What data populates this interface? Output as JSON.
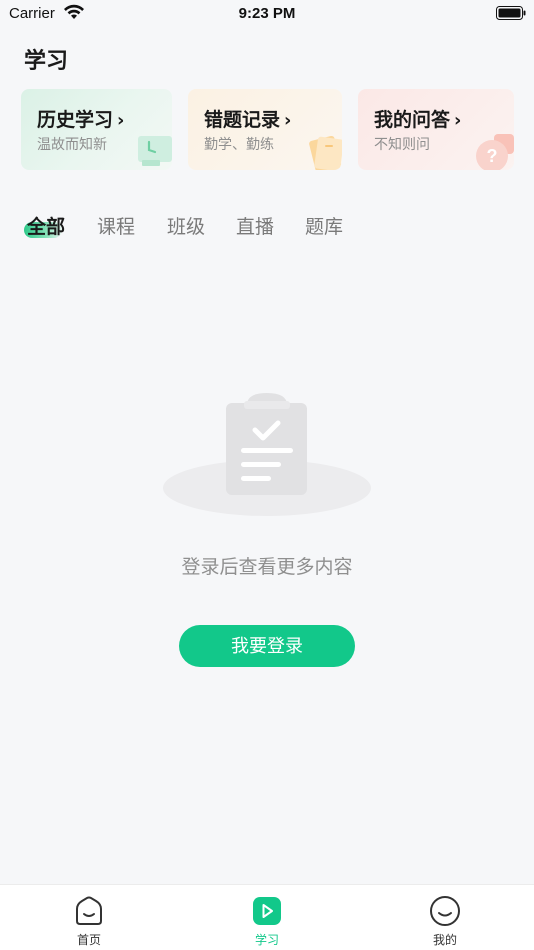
{
  "status_bar": {
    "carrier": "Carrier",
    "time": "9:23 PM"
  },
  "page": {
    "title": "学习"
  },
  "quick_cards": [
    {
      "title": "历史学习",
      "subtitle": "温故而知新",
      "icon": "monitor-clock-icon",
      "accent": "#2ec98a"
    },
    {
      "title": "错题记录",
      "subtitle": "勤学、勤练",
      "icon": "paper-stack-icon",
      "accent": "#f5b25b"
    },
    {
      "title": "我的问答",
      "subtitle": "不知则问",
      "icon": "question-bubble-icon",
      "accent": "#f28a7c"
    }
  ],
  "chevron": "›",
  "tabs": [
    {
      "label": "全部",
      "active": true
    },
    {
      "label": "课程",
      "active": false
    },
    {
      "label": "班级",
      "active": false
    },
    {
      "label": "直播",
      "active": false
    },
    {
      "label": "题库",
      "active": false
    }
  ],
  "empty_state": {
    "illustration": "clipboard-icon",
    "message": "登录后查看更多内容",
    "button_label": "我要登录"
  },
  "tab_bar": [
    {
      "label": "首页",
      "icon": "home-icon",
      "active": false
    },
    {
      "label": "学习",
      "icon": "play-icon",
      "active": true
    },
    {
      "label": "我的",
      "icon": "smile-icon",
      "active": false
    }
  ],
  "colors": {
    "brand": "#12c88a",
    "background": "#f6f7f9",
    "muted_text": "#8f8f8f"
  }
}
